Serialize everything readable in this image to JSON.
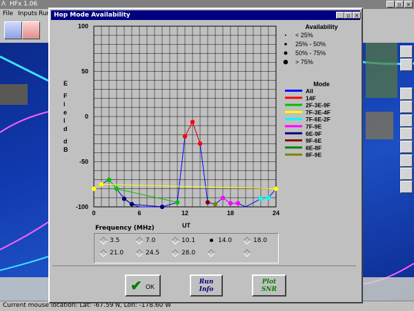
{
  "app": {
    "title": "HFx 1.06",
    "menus": [
      "File",
      "Inputs",
      "Run"
    ]
  },
  "status": {
    "mouse_location": "Current mouse location:  Lat: -67.59 N,  Lon: -178.60 W"
  },
  "dialog": {
    "title": "Hop Mode Availability",
    "ok_label": "OK",
    "run_info_label": "Run Info",
    "plot_snr_label": "Plot SNR"
  },
  "colors": {
    "title_active": "#000080",
    "map_ocean": "#1c4fc2"
  },
  "frequency": {
    "label": "Frequency (MHz)",
    "options": [
      "3.5",
      "7.0",
      "10.1",
      "14.0",
      "18.0",
      "21.0",
      "24.5",
      "28.0",
      "",
      ""
    ],
    "selected": "14.0"
  },
  "chart_data": {
    "type": "line",
    "ylabel": "E Field dB",
    "xlabel": "UT",
    "xlim": [
      0,
      24
    ],
    "ylim": [
      -100,
      100
    ],
    "x_ticks": [
      "0",
      "6",
      "12",
      "18",
      "24"
    ],
    "y_ticks": [
      "100",
      "50",
      "0",
      "-50",
      "-100"
    ],
    "availability_legend": {
      "title": "Availability",
      "items": [
        "< 25%",
        "25% - 50%",
        "50% - 75%",
        "> 75%"
      ]
    },
    "mode_legend": {
      "title": "Mode"
    },
    "series": [
      {
        "name": "All",
        "color": "#0000ff",
        "points": [
          [
            0,
            -80
          ],
          [
            1,
            -75
          ],
          [
            2,
            -70
          ],
          [
            3,
            -80
          ],
          [
            4,
            -91
          ],
          [
            5,
            -97
          ],
          [
            6,
            -100
          ],
          [
            9,
            -100
          ],
          [
            11,
            -95
          ],
          [
            12,
            -22
          ],
          [
            13,
            -6
          ],
          [
            14,
            -30
          ],
          [
            15,
            -95
          ],
          [
            16,
            -97
          ],
          [
            17,
            -90
          ],
          [
            18,
            -96
          ],
          [
            19,
            -96
          ],
          [
            20,
            -100
          ],
          [
            22,
            -91
          ],
          [
            23,
            -90
          ],
          [
            24,
            -80
          ]
        ]
      },
      {
        "name": "14F",
        "color": "#ff0000",
        "points": [
          [
            12,
            -22
          ],
          [
            13,
            -6
          ],
          [
            14,
            -30
          ]
        ]
      },
      {
        "name": "2F-3E-9F",
        "color": "#00c000",
        "points": [
          [
            2,
            -70
          ],
          [
            3,
            -80
          ],
          [
            11,
            -95
          ]
        ]
      },
      {
        "name": "7F-3E-4F",
        "color": "#ffff00",
        "points": [
          [
            0,
            -80
          ],
          [
            1,
            -75
          ],
          [
            24,
            -80
          ]
        ]
      },
      {
        "name": "7F-6E-2F",
        "color": "#00ffff",
        "points": [
          [
            22,
            -91
          ],
          [
            23,
            -90
          ]
        ]
      },
      {
        "name": "7F-9E",
        "color": "#ff00ff",
        "points": [
          [
            17,
            -90
          ],
          [
            18,
            -96
          ],
          [
            19,
            -96
          ]
        ]
      },
      {
        "name": "6E-9F",
        "color": "#000080",
        "points": [
          [
            4,
            -91
          ],
          [
            5,
            -97
          ],
          [
            9,
            -100
          ]
        ]
      },
      {
        "name": "9F-6E",
        "color": "#800000",
        "points": [
          [
            15,
            -95
          ]
        ]
      },
      {
        "name": "6E-8F",
        "color": "#008000",
        "points": []
      },
      {
        "name": "8F-9E",
        "color": "#808000",
        "points": [
          [
            16,
            -97
          ]
        ]
      }
    ]
  }
}
